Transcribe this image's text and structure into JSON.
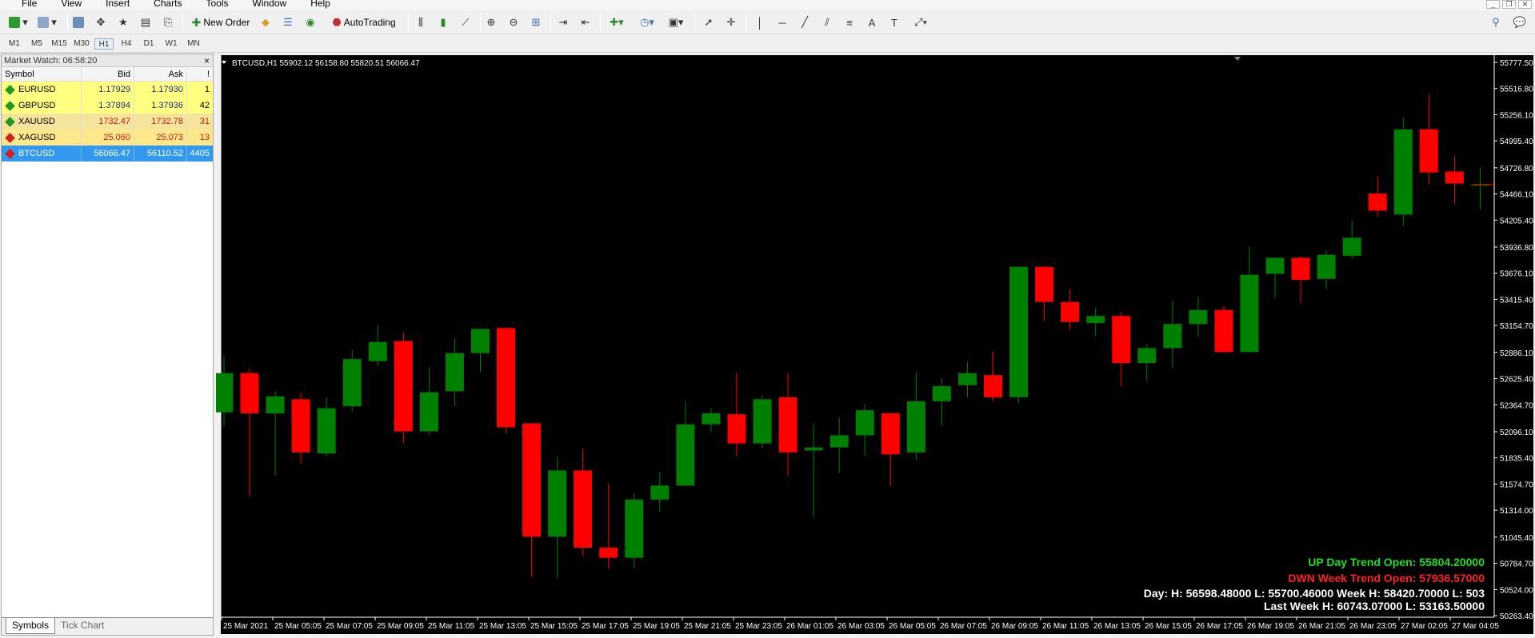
{
  "menu": [
    "File",
    "View",
    "Insert",
    "Charts",
    "Tools",
    "Window",
    "Help"
  ],
  "toolbar": {
    "new_order_label": "New Order",
    "autotrading_label": "AutoTrading"
  },
  "timeframes": [
    "M1",
    "M5",
    "M15",
    "M30",
    "H1",
    "H4",
    "D1",
    "W1",
    "MN"
  ],
  "active_timeframe": "H1",
  "market_watch": {
    "title": "Market Watch: 06:58:20",
    "columns": {
      "symbol": "Symbol",
      "bid": "Bid",
      "ask": "Ask",
      "spread": "!"
    },
    "rows": [
      {
        "symbol": "EURUSD",
        "bid": "1.17929",
        "ask": "1.17930",
        "spread": "1",
        "style": "yellow",
        "icon_color": "#1f9a1f"
      },
      {
        "symbol": "GBPUSD",
        "bid": "1.37894",
        "ask": "1.37936",
        "spread": "42",
        "style": "yellow",
        "icon_color": "#1f9a1f"
      },
      {
        "symbol": "XAUUSD",
        "bid": "1732.47",
        "ask": "1732.78",
        "spread": "31",
        "style": "orange2",
        "icon_color": "#1f9a1f"
      },
      {
        "symbol": "XAGUSD",
        "bid": "25.060",
        "ask": "25.073",
        "spread": "13",
        "style": "orange",
        "icon_color": "#d02020"
      },
      {
        "symbol": "BTCUSD",
        "bid": "56066.47",
        "ask": "56110.52",
        "spread": "4405",
        "style": "selected",
        "icon_color": "#d02020"
      }
    ],
    "tabs": [
      "Symbols",
      "Tick Chart"
    ]
  },
  "chart": {
    "header": "BTCUSD,H1  55902.12 56158.80 55820.51 56066.47",
    "colors": {
      "background": "#000000",
      "bull": "#008000",
      "bear": "#ff0000",
      "axis_text": "#ffffff"
    },
    "info_lines": [
      {
        "text": "UP Day Trend Open: 55804.20000",
        "color": "#22dd22"
      },
      {
        "text": "DWN Week Trend Open: 57936.57000",
        "color": "#ff2020"
      },
      {
        "text": "Day: H: 56598.48000 L: 55700.46000   Week H: 58420.70000 L: 503",
        "color": "#ffffff"
      },
      {
        "text": "Last Week H: 60743.07000 L: 53163.50000",
        "color": "#ffffff"
      }
    ]
  },
  "chart_data": {
    "type": "candlestick",
    "title": "BTCUSD,H1",
    "ylim": [
      50000,
      55900
    ],
    "y_ticks": [
      "55777.50",
      "55516.80",
      "55256.10",
      "54995.40",
      "54726.80",
      "54466.10",
      "54205.40",
      "53936.80",
      "53676.10",
      "53415.40",
      "53154.70",
      "52886.10",
      "52625.40",
      "52364.70",
      "52096.10",
      "51835.40",
      "51574.70",
      "51314.00",
      "51045.40",
      "50784.70",
      "50524.00",
      "50263.40"
    ],
    "x_ticks": [
      "25 Mar 2021",
      "25 Mar 05:05",
      "25 Mar 07:05",
      "25 Mar 09:05",
      "25 Mar 11:05",
      "25 Mar 13:05",
      "25 Mar 15:05",
      "25 Mar 17:05",
      "25 Mar 19:05",
      "25 Mar 21:05",
      "25 Mar 23:05",
      "26 Mar 01:05",
      "26 Mar 03:05",
      "26 Mar 05:05",
      "26 Mar 07:05",
      "26 Mar 09:05",
      "26 Mar 11:05",
      "26 Mar 13:05",
      "26 Mar 15:05",
      "26 Mar 17:05",
      "26 Mar 19:05",
      "26 Mar 21:05",
      "26 Mar 23:05",
      "27 Mar 02:05",
      "27 Mar 04:05"
    ],
    "candles": [
      {
        "o": 52290,
        "h": 52850,
        "l": 52150,
        "c": 52680
      },
      {
        "o": 52680,
        "h": 52730,
        "l": 51450,
        "c": 52280
      },
      {
        "o": 52280,
        "h": 52500,
        "l": 51660,
        "c": 52450
      },
      {
        "o": 52420,
        "h": 52490,
        "l": 51780,
        "c": 51890
      },
      {
        "o": 51880,
        "h": 52440,
        "l": 51850,
        "c": 52330
      },
      {
        "o": 52350,
        "h": 52910,
        "l": 52300,
        "c": 52820
      },
      {
        "o": 52800,
        "h": 53160,
        "l": 52750,
        "c": 52990
      },
      {
        "o": 53000,
        "h": 53090,
        "l": 51980,
        "c": 52100
      },
      {
        "o": 52100,
        "h": 52740,
        "l": 52060,
        "c": 52490
      },
      {
        "o": 52500,
        "h": 53030,
        "l": 52350,
        "c": 52880
      },
      {
        "o": 52880,
        "h": 53130,
        "l": 52690,
        "c": 53120
      },
      {
        "o": 53130,
        "h": 53130,
        "l": 52080,
        "c": 52140
      },
      {
        "o": 52180,
        "h": 52180,
        "l": 50650,
        "c": 51050
      },
      {
        "o": 51050,
        "h": 51850,
        "l": 50640,
        "c": 51710
      },
      {
        "o": 51710,
        "h": 51930,
        "l": 50860,
        "c": 50940
      },
      {
        "o": 50940,
        "h": 51580,
        "l": 50730,
        "c": 50840
      },
      {
        "o": 50840,
        "h": 51480,
        "l": 50740,
        "c": 51420
      },
      {
        "o": 51420,
        "h": 51690,
        "l": 51300,
        "c": 51560
      },
      {
        "o": 51560,
        "h": 52400,
        "l": 51550,
        "c": 52170
      },
      {
        "o": 52170,
        "h": 52330,
        "l": 52090,
        "c": 52280
      },
      {
        "o": 52270,
        "h": 52680,
        "l": 51850,
        "c": 51980
      },
      {
        "o": 51980,
        "h": 52460,
        "l": 51930,
        "c": 52420
      },
      {
        "o": 52440,
        "h": 52680,
        "l": 51660,
        "c": 51890
      },
      {
        "o": 51910,
        "h": 52170,
        "l": 51240,
        "c": 51940
      },
      {
        "o": 51940,
        "h": 52240,
        "l": 51690,
        "c": 52060
      },
      {
        "o": 52060,
        "h": 52370,
        "l": 51860,
        "c": 52310
      },
      {
        "o": 52280,
        "h": 52280,
        "l": 51550,
        "c": 51870
      },
      {
        "o": 51890,
        "h": 52680,
        "l": 51820,
        "c": 52400
      },
      {
        "o": 52400,
        "h": 52630,
        "l": 52160,
        "c": 52550
      },
      {
        "o": 52560,
        "h": 52790,
        "l": 52440,
        "c": 52680
      },
      {
        "o": 52660,
        "h": 52890,
        "l": 52400,
        "c": 52440
      },
      {
        "o": 52440,
        "h": 53740,
        "l": 52380,
        "c": 53740
      },
      {
        "o": 53740,
        "h": 53740,
        "l": 53200,
        "c": 53390
      },
      {
        "o": 53390,
        "h": 53520,
        "l": 53110,
        "c": 53190
      },
      {
        "o": 53180,
        "h": 53330,
        "l": 53050,
        "c": 53250
      },
      {
        "o": 53250,
        "h": 53290,
        "l": 52550,
        "c": 52780
      },
      {
        "o": 52780,
        "h": 52970,
        "l": 52600,
        "c": 52930
      },
      {
        "o": 52930,
        "h": 53400,
        "l": 52730,
        "c": 53170
      },
      {
        "o": 53170,
        "h": 53440,
        "l": 53040,
        "c": 53310
      },
      {
        "o": 53310,
        "h": 53350,
        "l": 52880,
        "c": 52890
      },
      {
        "o": 52890,
        "h": 53940,
        "l": 52890,
        "c": 53660
      },
      {
        "o": 53670,
        "h": 53810,
        "l": 53430,
        "c": 53830
      },
      {
        "o": 53830,
        "h": 53850,
        "l": 53380,
        "c": 53610
      },
      {
        "o": 53620,
        "h": 53900,
        "l": 53520,
        "c": 53860
      },
      {
        "o": 53850,
        "h": 54200,
        "l": 53820,
        "c": 54030
      },
      {
        "o": 54470,
        "h": 54640,
        "l": 54240,
        "c": 54300
      },
      {
        "o": 54260,
        "h": 55230,
        "l": 54150,
        "c": 55110
      },
      {
        "o": 55110,
        "h": 55460,
        "l": 54560,
        "c": 54680
      },
      {
        "o": 54690,
        "h": 54840,
        "l": 54370,
        "c": 54570
      },
      {
        "o": 54560,
        "h": 54730,
        "l": 54310,
        "c": 54560
      }
    ]
  }
}
